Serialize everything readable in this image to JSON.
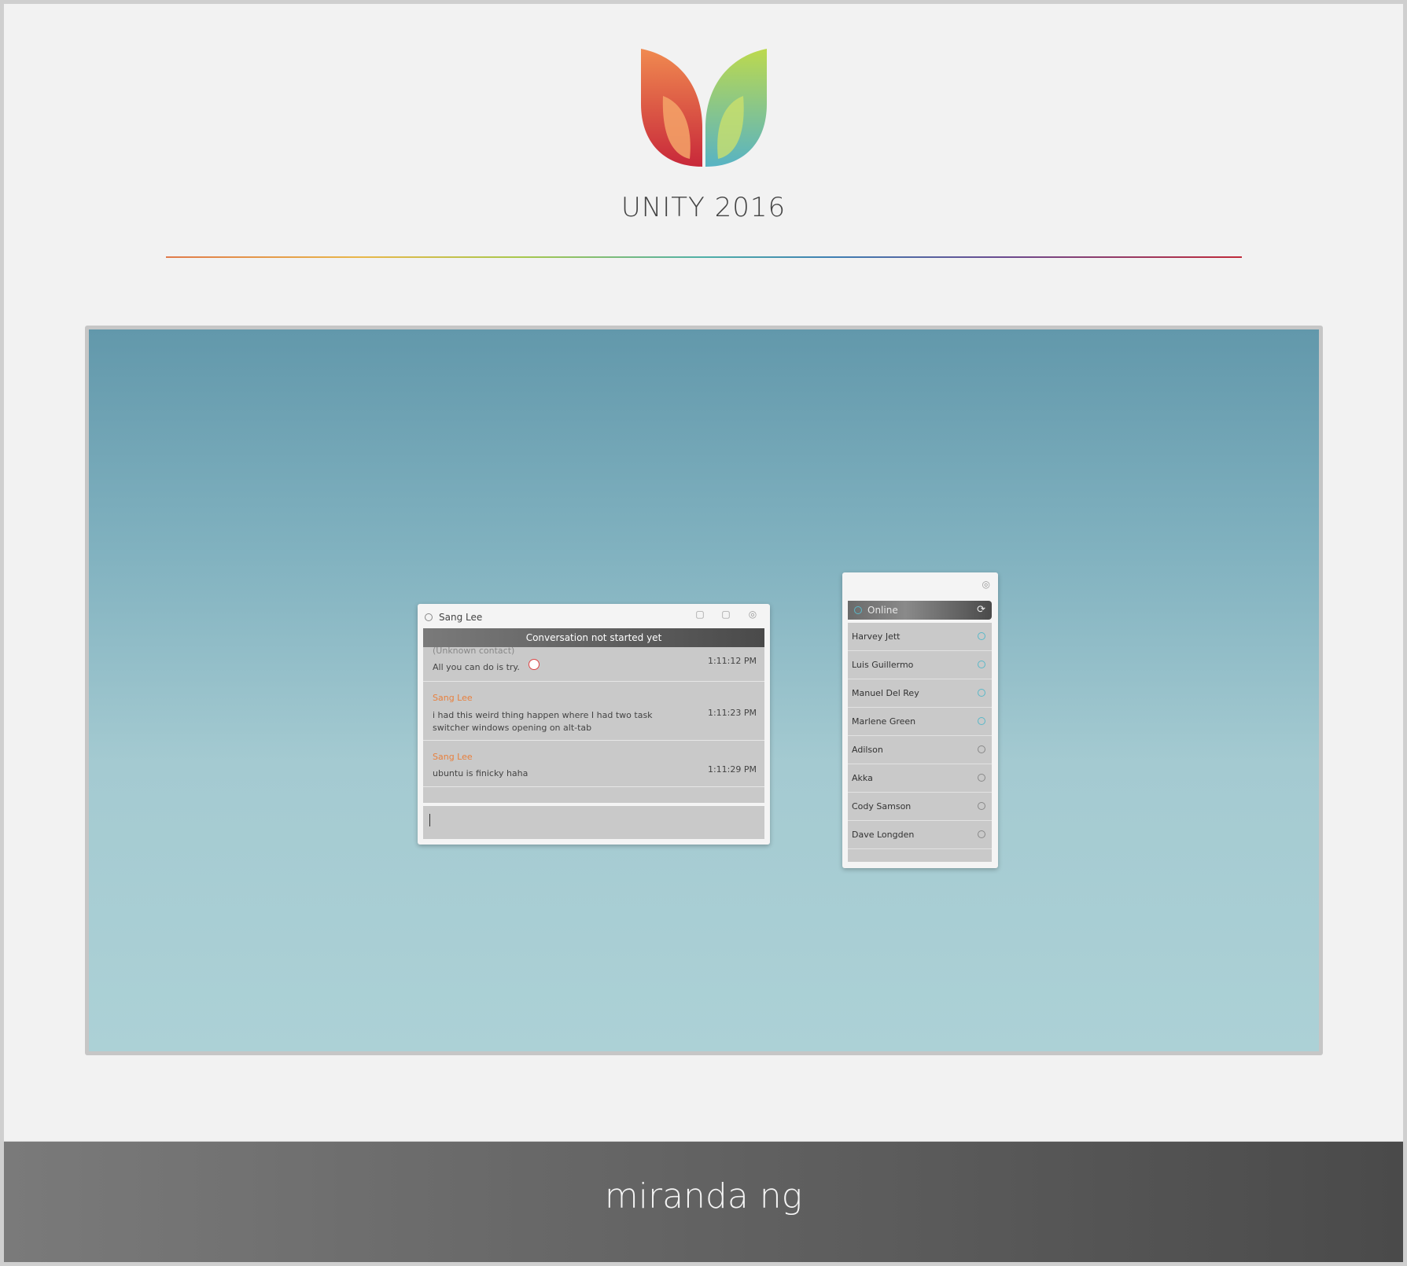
{
  "brand": {
    "title": "UNITY 2016",
    "footer": "miranda ng",
    "colors": {
      "orange": "#e0703e",
      "green": "#a5cd4a",
      "teal": "#5ab8c8"
    }
  },
  "chat": {
    "contact_name": "Sang Lee",
    "banner": "Conversation not started yet",
    "messages": [
      {
        "from": "(Unknown contact)",
        "text": "All you can do is try.",
        "time": "1:11:12 PM",
        "emoji": "smiley-icon"
      },
      {
        "from": "Sang Lee",
        "text": "i had this weird thing happen where I had two task switcher windows opening on alt-tab",
        "time": "1:11:23 PM"
      },
      {
        "from": "Sang Lee",
        "text": "ubuntu is finicky haha",
        "time": "1:11:29 PM"
      }
    ],
    "input_value": ""
  },
  "contacts": {
    "status": "Online",
    "items": [
      {
        "name": "Harvey Jett",
        "online": true
      },
      {
        "name": "Luis Guillermo",
        "online": true
      },
      {
        "name": "Manuel Del Rey",
        "online": true
      },
      {
        "name": "Marlene Green",
        "online": true
      },
      {
        "name": "Adilson",
        "online": false
      },
      {
        "name": "Akka",
        "online": false
      },
      {
        "name": "Cody Samson",
        "online": false
      },
      {
        "name": "Dave Longden",
        "online": false
      }
    ]
  }
}
